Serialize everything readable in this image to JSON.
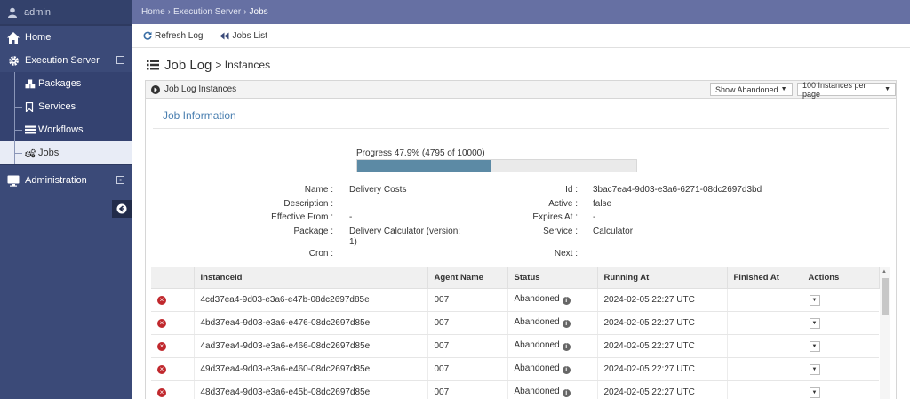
{
  "user": {
    "name": "admin"
  },
  "sidebar": {
    "home": "Home",
    "execution_server": "Execution Server",
    "sub_items": [
      "Packages",
      "Services",
      "Workflows",
      "Jobs"
    ],
    "administration": "Administration"
  },
  "breadcrumb": {
    "home": "Home",
    "section": "Execution Server",
    "current": "Jobs"
  },
  "toolbar": {
    "refresh": "Refresh Log",
    "jobs_list": "Jobs List"
  },
  "page": {
    "title": "Job Log",
    "subtitle": "> Instances"
  },
  "panel": {
    "title": "Job Log Instances",
    "filter_button": "Show Abandoned",
    "page_size_button": "100 Instances per page"
  },
  "job_info": {
    "section_title": "Job Information",
    "progress_label": "Progress 47.9% (4795 of 10000)",
    "progress_fraction": 0.479,
    "left": {
      "name_label": "Name :",
      "name_value": "Delivery Costs",
      "description_label": "Description :",
      "description_value": "",
      "effective_label": "Effective From :",
      "effective_value": "-",
      "package_label": "Package :",
      "package_value_line1": "Delivery Calculator (version:",
      "package_value_line2": "1)",
      "cron_label": "Cron :",
      "cron_value": ""
    },
    "right": {
      "id_label": "Id :",
      "id_value": "3bac7ea4-9d03-e3a6-6271-08dc2697d3bd",
      "active_label": "Active :",
      "active_value": "false",
      "expires_label": "Expires At :",
      "expires_value": "-",
      "service_label": "Service :",
      "service_value": "Calculator",
      "next_label": "Next :",
      "next_value": ""
    }
  },
  "table": {
    "headers": [
      "",
      "InstanceId",
      "Agent Name",
      "Status",
      "Running At",
      "Finished At",
      "Actions"
    ],
    "rows": [
      {
        "id": "4cd37ea4-9d03-e3a6-e47b-08dc2697d85e",
        "agent": "007",
        "status": "Abandoned",
        "running": "2024-02-05 22:27 UTC",
        "finished": ""
      },
      {
        "id": "4bd37ea4-9d03-e3a6-e476-08dc2697d85e",
        "agent": "007",
        "status": "Abandoned",
        "running": "2024-02-05 22:27 UTC",
        "finished": ""
      },
      {
        "id": "4ad37ea4-9d03-e3a6-e466-08dc2697d85e",
        "agent": "007",
        "status": "Abandoned",
        "running": "2024-02-05 22:27 UTC",
        "finished": ""
      },
      {
        "id": "49d37ea4-9d03-e3a6-e460-08dc2697d85e",
        "agent": "007",
        "status": "Abandoned",
        "running": "2024-02-05 22:27 UTC",
        "finished": ""
      },
      {
        "id": "48d37ea4-9d03-e3a6-e45b-08dc2697d85e",
        "agent": "007",
        "status": "Abandoned",
        "running": "2024-02-05 22:27 UTC",
        "finished": ""
      }
    ]
  },
  "colors": {
    "sidebar": "#3b4a78",
    "topbar": "#6670a3",
    "progress": "#5c8aa5",
    "accent": "#4a7fb0",
    "error": "#c0282d"
  },
  "icons": [
    "user-icon",
    "home-icon",
    "gear-icon",
    "cubes-icon",
    "bookmark-icon",
    "list-icon",
    "cogs-icon",
    "monitor-icon",
    "arrow-left-icon",
    "refresh-icon",
    "back-icon",
    "list-icon",
    "play-icon",
    "error-icon",
    "info-icon",
    "caret-down-icon"
  ]
}
